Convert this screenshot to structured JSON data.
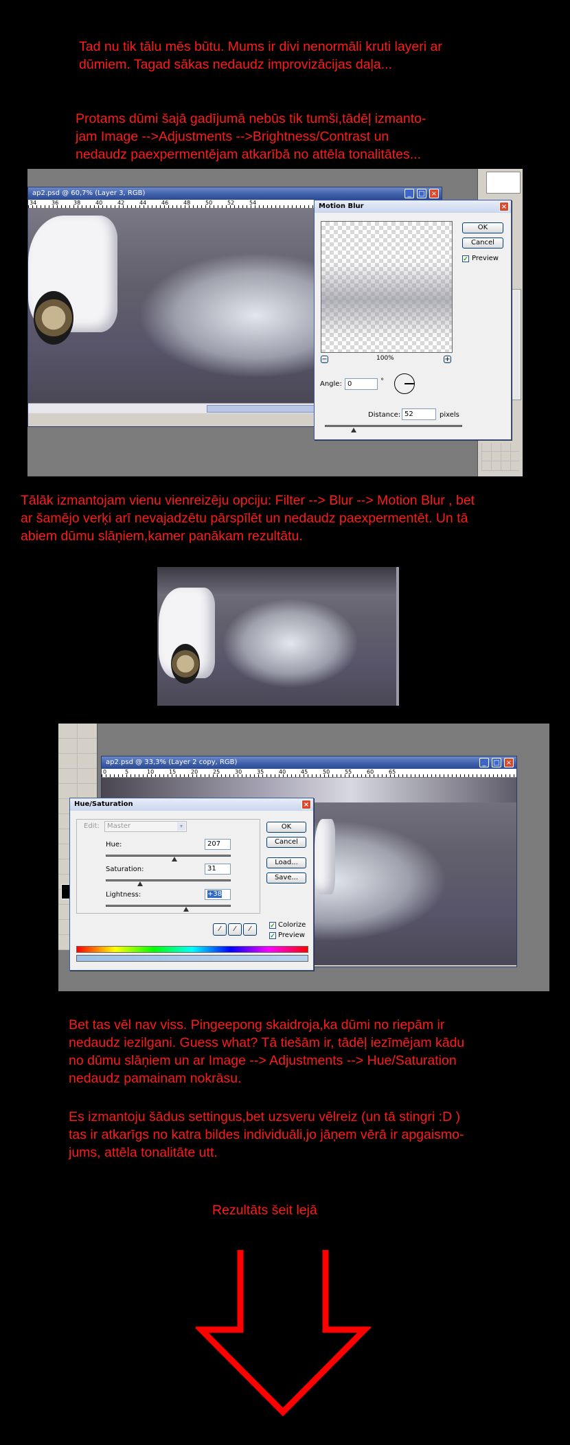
{
  "paragraphs": {
    "p1": [
      "Tad nu tik tālu mēs būtu. Mums ir divi nenormāli kruti layeri ar",
      "dūmiem. Tagad sākas nedaudz improvizācijas daļa..."
    ],
    "p2": [
      "Protams dūmi šajā gadījumā nebūs tik tumši,tādēļ izmanto-",
      "jam Image -->Adjustments -->Brightness/Contrast un",
      "nedaudz paexpermentējam atkarībā no attēla tonalitātes..."
    ],
    "p3": [
      "Tālāk izmantojam vienu vienreizēju opciju: Filter --> Blur --> Motion Blur , bet",
      "ar šamējo verķi arī nevajadzētu pārspīlēt un nedaudz paexpermentēt. Un tā",
      "abiem dūmu slāņiem,kamer panākam rezultātu."
    ],
    "p4": [
      "Bet tas vēl nav viss. Pingeepong skaidroja,ka dūmi no riepām ir",
      "nedaudz iezilgani. Guess what? Tā tiešām ir, tādēļ iezīmējam kādu",
      "no dūmu slāņiem un ar Image --> Adjustments --> Hue/Saturation",
      "nedaudz pamainam nokrāsu."
    ],
    "p5": [
      "Es izmantoju šādus settingus,bet uzsveru vēlreiz (un tā stingri :D )",
      "tas ir atkarīgs no katra bildes individuāli,jo jāņem vērā ir apgaismo-",
      "jums, attēla tonalitāte utt."
    ],
    "p6": "Rezultāts šeit lejā"
  },
  "screenshot1": {
    "window_title": "ap2.psd @ 60,7% (Layer 3, RGB)",
    "ruler_ticks": [
      "34",
      "36",
      "38",
      "40",
      "42",
      "44",
      "46",
      "48",
      "50",
      "52",
      "54"
    ],
    "dialog": {
      "title": "Motion Blur",
      "ok": "OK",
      "cancel": "Cancel",
      "preview_label": "Preview",
      "preview_checked": true,
      "zoom": "100%",
      "zoom_out": "−",
      "zoom_in": "+",
      "angle_label": "Angle:",
      "angle_value": "0",
      "angle_unit": "°",
      "distance_label": "Distance:",
      "distance_value": "52",
      "distance_unit": "pixels"
    }
  },
  "screenshot3": {
    "window_title": "ap2.psd @ 33,3% (Layer 2 copy, RGB)",
    "ruler_ticks": [
      "0",
      "5",
      "10",
      "15",
      "20",
      "25",
      "30",
      "35",
      "40",
      "45",
      "50",
      "55",
      "60",
      "65"
    ],
    "dialog": {
      "title": "Hue/Saturation",
      "edit_label": "Edit:",
      "edit_value": "Master",
      "hue_label": "Hue:",
      "hue_value": "207",
      "saturation_label": "Saturation:",
      "saturation_value": "31",
      "lightness_label": "Lightness:",
      "lightness_value": "+38",
      "ok": "OK",
      "cancel": "Cancel",
      "load": "Load...",
      "save": "Save...",
      "colorize_label": "Colorize",
      "colorize_checked": true,
      "preview_label": "Preview",
      "preview_checked": true
    }
  },
  "colors": {
    "text": "#ff1a1a",
    "arrow": "#ff0000",
    "background": "#000000"
  },
  "icons": [
    "minimize-icon",
    "maximize-icon",
    "close-icon",
    "eyedropper-icon",
    "eyedropper-plus-icon",
    "eyedropper-minus-icon",
    "down-arrow-graphic"
  ]
}
